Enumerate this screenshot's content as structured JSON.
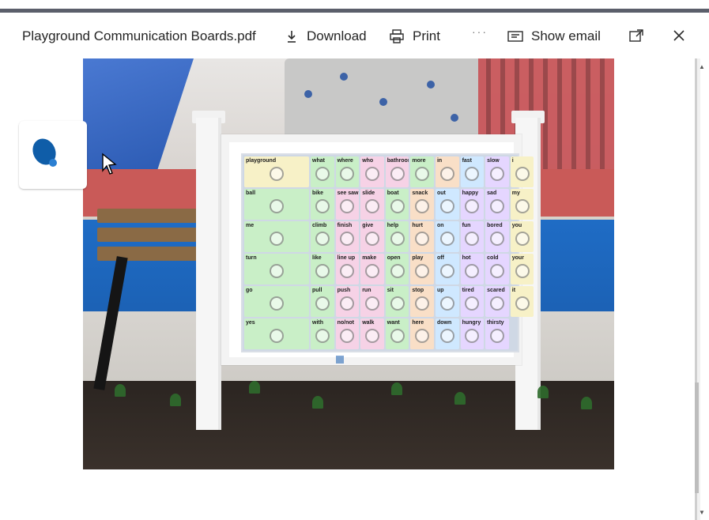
{
  "toolbar": {
    "file_title": "Playground Communication Boards.pdf",
    "download_label": "Download",
    "print_label": "Print",
    "more_label": "···",
    "show_email_label": "Show email",
    "icons": [
      "download-icon",
      "print-icon",
      "more-icon",
      "show-email-icon",
      "open-in-new-icon",
      "close-icon"
    ]
  },
  "viewer": {
    "loading_indicator": "loading-spinner",
    "image_alt": "playground communication board photo"
  },
  "sign_board": {
    "rows": [
      [
        "playground",
        "what",
        "where",
        "who",
        "bathroom",
        "more",
        "in",
        "fast",
        "slow"
      ],
      [
        "I",
        "ball",
        "bike",
        "See Saw",
        "slide",
        "boat",
        "snack",
        "out",
        "happy",
        "sad"
      ],
      [
        "my",
        "me",
        "climb",
        "finish",
        "give",
        "help",
        "hurt",
        "on",
        "fun",
        "bored"
      ],
      [
        "you",
        "turn",
        "like",
        "line up",
        "make",
        "open",
        "play",
        "off",
        "hot",
        "cold"
      ],
      [
        "your",
        "go",
        "pull",
        "push",
        "run",
        "sit",
        "stop",
        "up",
        "tired",
        "scared"
      ],
      [
        "it",
        "yes",
        "with",
        "no/not",
        "walk",
        "want",
        "here",
        "down",
        "hungry",
        "thirsty"
      ]
    ],
    "colors": {
      "yellow": "#f7f1c7",
      "green": "#c9efc7",
      "blue": "#cfe8ff",
      "pink": "#f6d2e6",
      "orange": "#f9dfc7",
      "purple": "#e5d6ff"
    }
  },
  "colors": {
    "top_bar": "#5b5f6b",
    "text": "#242424",
    "accent_blue": "#0f5da8"
  }
}
